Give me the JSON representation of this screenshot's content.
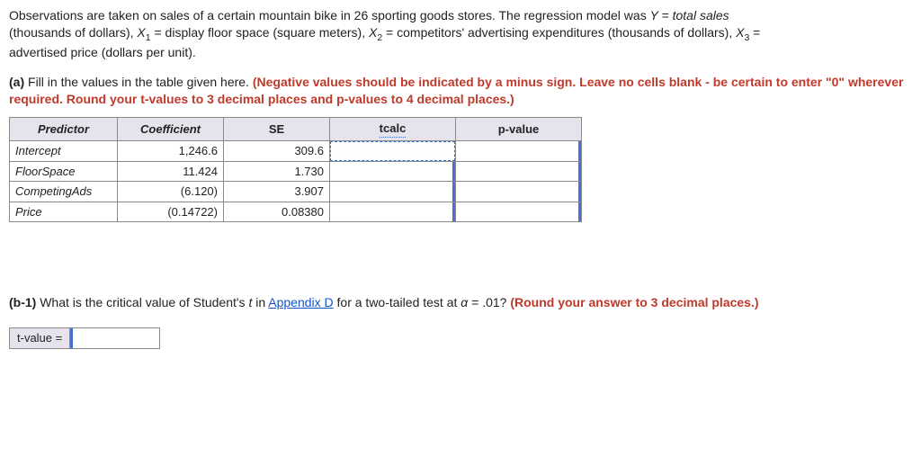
{
  "intro": {
    "line1a": "Observations are taken on sales of a certain mountain bike in 26 sporting goods stores. The regression model was ",
    "Yeq": "Y = total sales",
    "line2a": "(thousands of dollars), ",
    "x1lbl": "X",
    "x1sub": "1",
    "x1def": " = display floor space (square meters), ",
    "x2lbl": "X",
    "x2sub": "2",
    "x2def": " = competitors' advertising expenditures (thousands of dollars), ",
    "x3lbl": "X",
    "x3sub": "3",
    "x3def": " =",
    "line3": "advertised price (dollars per unit)."
  },
  "partA": {
    "tag": "(a)",
    "text": " Fill in the values in the table given here. ",
    "red": "(Negative values should be indicated by a minus sign. Leave no cells blank - be certain to enter \"0\" wherever required. Round your t-values to 3 decimal places and p-values to 4 decimal places.)"
  },
  "table": {
    "headers": {
      "predictor": "Predictor",
      "coef": "Coefficient",
      "se": "SE",
      "tcalc": "tcalc",
      "pval": "p-value"
    },
    "rows": [
      {
        "name": "Intercept",
        "coef": "1,246.6",
        "se": "309.6"
      },
      {
        "name": "FloorSpace",
        "coef": "11.424",
        "se": "1.730"
      },
      {
        "name": "CompetingAds",
        "coef": "(6.120)",
        "se": "3.907"
      },
      {
        "name": "Price",
        "coef": "(0.14722)",
        "se": "0.08380"
      }
    ]
  },
  "partB": {
    "tag": "(b-1)",
    "text1": " What is the critical value of Student's ",
    "t": "t",
    "text2": " in ",
    "appendix": "Appendix D",
    "text3": " for a two-tailed test at ",
    "alpha": "α",
    "alphaVal": " = .01? ",
    "red": "(Round your answer to 3 decimal places.)"
  },
  "tvalue": {
    "label": "t-value ="
  }
}
